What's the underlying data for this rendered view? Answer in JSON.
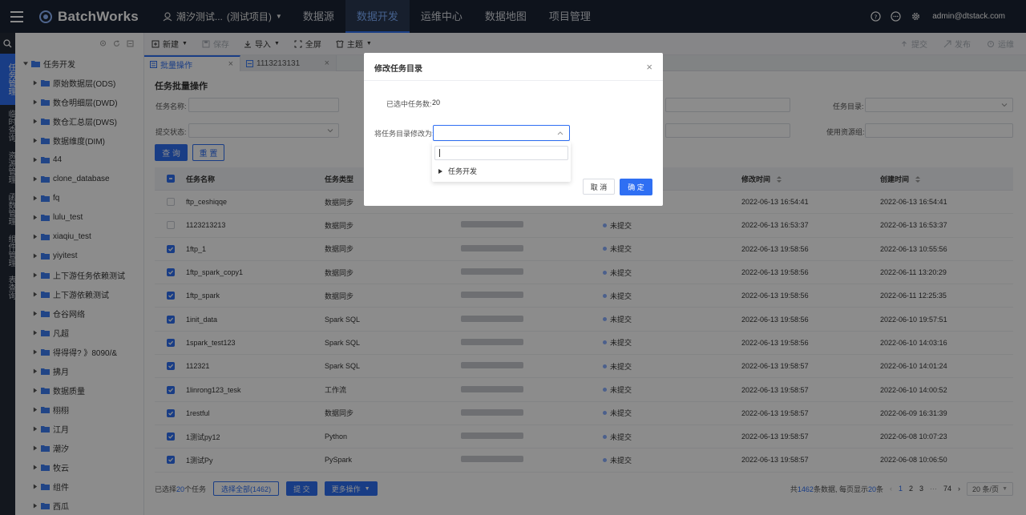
{
  "topbar": {
    "logo_text": "BatchWorks",
    "project_name": "潮汐测试...",
    "project_tag": "(测试项目)",
    "nav": [
      "数据源",
      "数据开发",
      "运维中心",
      "数据地图",
      "项目管理"
    ],
    "active_nav": "数据开发",
    "user": "admin@dtstack.com"
  },
  "rail": {
    "items": [
      "任务管理",
      "临时查询",
      "资源管理",
      "函数管理",
      "组件管理",
      "表查询"
    ]
  },
  "tree": {
    "root": "任务开发",
    "items": [
      "原始数据层(ODS)",
      "数仓明细层(DWD)",
      "数仓汇总层(DWS)",
      "数据维度(DIM)",
      "44",
      "clone_database",
      "fq",
      "lulu_test",
      "xiaqiu_test",
      "yiyitest",
      "上下游任务依赖测试",
      "上下游依赖测试",
      "仓谷网络",
      "凡超",
      "得得得? 》8090/&",
      "拂月",
      "数据质量",
      "栩栩",
      "江月",
      "潮汐",
      "牧云",
      "组件",
      "西瓜"
    ]
  },
  "toolbar": {
    "new": "新建",
    "save": "保存",
    "import": "导入",
    "fullscreen": "全屏",
    "theme": "主题",
    "submit": "提交",
    "publish": "发布",
    "ops": "运维"
  },
  "tabs": [
    {
      "label": "批量操作",
      "active": true
    },
    {
      "label": "1113213131",
      "active": false
    }
  ],
  "panel": {
    "title": "任务批量操作",
    "name_label": "任务名称:",
    "status_label": "提交状态:",
    "dir_label": "任务目录:",
    "resgroup_label": "使用资源组:",
    "query_btn": "查 询",
    "reset_btn": "重 置"
  },
  "table": {
    "columns": [
      "任务名称",
      "任务类型",
      "",
      "",
      "修改时间",
      "创建时间"
    ],
    "rows": [
      {
        "checked": false,
        "name": "ftp_ceshiqqe",
        "type": "数据同步",
        "status": "",
        "modified": "2022-06-13 16:54:41",
        "created": "2022-06-13 16:54:41"
      },
      {
        "checked": false,
        "name": "1123213213",
        "type": "数据同步",
        "status": "未提交",
        "modified": "2022-06-13 16:53:37",
        "created": "2022-06-13 16:53:37"
      },
      {
        "checked": true,
        "name": "1ftp_1",
        "type": "数据同步",
        "status": "未提交",
        "modified": "2022-06-13 19:58:56",
        "created": "2022-06-13 10:55:56"
      },
      {
        "checked": true,
        "name": "1ftp_spark_copy1",
        "type": "数据同步",
        "status": "未提交",
        "modified": "2022-06-13 19:58:56",
        "created": "2022-06-11 13:20:29"
      },
      {
        "checked": true,
        "name": "1ftp_spark",
        "type": "数据同步",
        "status": "未提交",
        "modified": "2022-06-13 19:58:56",
        "created": "2022-06-11 12:25:35"
      },
      {
        "checked": true,
        "name": "1init_data",
        "type": "Spark SQL",
        "status": "未提交",
        "modified": "2022-06-13 19:58:56",
        "created": "2022-06-10 19:57:51"
      },
      {
        "checked": true,
        "name": "1spark_test123",
        "type": "Spark SQL",
        "status": "未提交",
        "modified": "2022-06-13 19:58:56",
        "created": "2022-06-10 14:03:16"
      },
      {
        "checked": true,
        "name": "112321",
        "type": "Spark SQL",
        "status": "未提交",
        "modified": "2022-06-13 19:58:57",
        "created": "2022-06-10 14:01:24"
      },
      {
        "checked": true,
        "name": "1linrong123_tesk",
        "type": "工作流",
        "status": "未提交",
        "modified": "2022-06-13 19:58:57",
        "created": "2022-06-10 14:00:52"
      },
      {
        "checked": true,
        "name": "1restful",
        "type": "数据同步",
        "status": "未提交",
        "modified": "2022-06-13 19:58:57",
        "created": "2022-06-09 16:31:39"
      },
      {
        "checked": true,
        "name": "1测试py12",
        "type": "Python",
        "status": "未提交",
        "modified": "2022-06-13 19:58:57",
        "created": "2022-06-08 10:07:23"
      },
      {
        "checked": true,
        "name": "1测试Py",
        "type": "PySpark",
        "status": "未提交",
        "modified": "2022-06-13 19:58:57",
        "created": "2022-06-08 10:06:50"
      }
    ]
  },
  "footer": {
    "selected_prefix": "已选择",
    "selected_count": "20",
    "selected_suffix": "个任务",
    "select_all": "选择全部(1462)",
    "submit": "提 交",
    "more": "更多操作",
    "total_prefix": "共",
    "total": "1462",
    "total_mid": "条数据, 每页显示",
    "page_size_num": "20",
    "total_suffix": "条",
    "pages": [
      "1",
      "2",
      "3",
      "···",
      "74"
    ],
    "page_size": "20 条/页"
  },
  "modal": {
    "title": "修改任务目录",
    "selected_label": "已选中任务数:",
    "selected_value": "20",
    "change_label": "将任务目录修改为:",
    "tree_option": "任务开发",
    "cancel": "取 消",
    "ok": "确 定"
  }
}
